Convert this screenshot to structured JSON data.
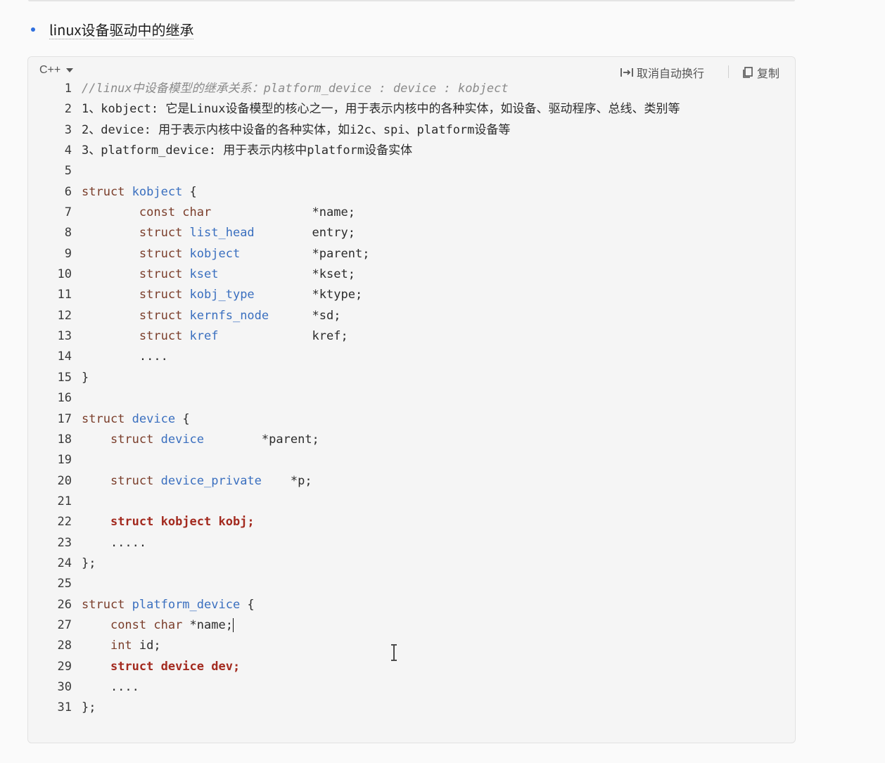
{
  "bullet": {
    "text": "linux设备驱动中的继承"
  },
  "code_block": {
    "language": "C++",
    "wrap_toggle_label": "取消自动换行",
    "copy_label": "复制",
    "line_numbers": [
      "1",
      "2",
      "3",
      "4",
      "5",
      "6",
      "7",
      "8",
      "9",
      "10",
      "11",
      "12",
      "13",
      "14",
      "15",
      "16",
      "17",
      "18",
      "19",
      "20",
      "21",
      "22",
      "23",
      "24",
      "25",
      "26",
      "27",
      "28",
      "29",
      "30",
      "31"
    ],
    "lines": [
      [
        {
          "t": "//linux中设备模型的继承关系：platform_device : device : kobject",
          "c": "comment"
        }
      ],
      [
        {
          "t": "1、kobject: 它是Linux设备模型的核心之一，用于表示内核中的各种实体，如设备、驱动程序、总线、类别等",
          "c": "plain"
        }
      ],
      [
        {
          "t": "2、device: 用于表示内核中设备的各种实体，如i2c、spi、platform设备等",
          "c": "plain"
        }
      ],
      [
        {
          "t": "3、platform_device: 用于表示内核中platform设备实体",
          "c": "plain"
        }
      ],
      [],
      [
        {
          "t": "struct ",
          "c": "kw"
        },
        {
          "t": "kobject",
          "c": "type"
        },
        {
          "t": " {",
          "c": "plain"
        }
      ],
      [
        {
          "t": "        ",
          "c": "plain"
        },
        {
          "t": "const char",
          "c": "kw"
        },
        {
          "t": "              *name;",
          "c": "plain"
        }
      ],
      [
        {
          "t": "        ",
          "c": "plain"
        },
        {
          "t": "struct ",
          "c": "kw"
        },
        {
          "t": "list_head",
          "c": "type"
        },
        {
          "t": "        entry;",
          "c": "plain"
        }
      ],
      [
        {
          "t": "        ",
          "c": "plain"
        },
        {
          "t": "struct ",
          "c": "kw"
        },
        {
          "t": "kobject",
          "c": "type"
        },
        {
          "t": "          *parent;",
          "c": "plain"
        }
      ],
      [
        {
          "t": "        ",
          "c": "plain"
        },
        {
          "t": "struct ",
          "c": "kw"
        },
        {
          "t": "kset",
          "c": "type"
        },
        {
          "t": "             *kset;",
          "c": "plain"
        }
      ],
      [
        {
          "t": "        ",
          "c": "plain"
        },
        {
          "t": "struct ",
          "c": "kw"
        },
        {
          "t": "kobj_type",
          "c": "type"
        },
        {
          "t": "        *ktype;",
          "c": "plain"
        }
      ],
      [
        {
          "t": "        ",
          "c": "plain"
        },
        {
          "t": "struct ",
          "c": "kw"
        },
        {
          "t": "kernfs_node",
          "c": "type"
        },
        {
          "t": "      *sd;",
          "c": "plain"
        }
      ],
      [
        {
          "t": "        ",
          "c": "plain"
        },
        {
          "t": "struct ",
          "c": "kw"
        },
        {
          "t": "kref",
          "c": "type"
        },
        {
          "t": "             kref;",
          "c": "plain"
        }
      ],
      [
        {
          "t": "        ....",
          "c": "plain"
        }
      ],
      [
        {
          "t": "}",
          "c": "plain"
        }
      ],
      [],
      [
        {
          "t": "struct ",
          "c": "kw"
        },
        {
          "t": "device",
          "c": "type"
        },
        {
          "t": " {",
          "c": "plain"
        }
      ],
      [
        {
          "t": "    ",
          "c": "plain"
        },
        {
          "t": "struct ",
          "c": "kw"
        },
        {
          "t": "device",
          "c": "type"
        },
        {
          "t": "        *parent;",
          "c": "plain"
        }
      ],
      [],
      [
        {
          "t": "    ",
          "c": "plain"
        },
        {
          "t": "struct ",
          "c": "kw"
        },
        {
          "t": "device_private",
          "c": "type"
        },
        {
          "t": "    *p;",
          "c": "plain"
        }
      ],
      [],
      [
        {
          "t": "    ",
          "c": "plain"
        },
        {
          "t": "struct kobject kobj;",
          "c": "strong"
        }
      ],
      [
        {
          "t": "    .....",
          "c": "plain"
        }
      ],
      [
        {
          "t": "};",
          "c": "plain"
        }
      ],
      [],
      [
        {
          "t": "struct ",
          "c": "kw"
        },
        {
          "t": "platform_device",
          "c": "type"
        },
        {
          "t": " {",
          "c": "plain"
        }
      ],
      [
        {
          "t": "    ",
          "c": "plain"
        },
        {
          "t": "const char",
          "c": "kw"
        },
        {
          "t": " *name;",
          "c": "plain"
        },
        {
          "t": "",
          "c": "caret"
        }
      ],
      [
        {
          "t": "    ",
          "c": "plain"
        },
        {
          "t": "int",
          "c": "kw"
        },
        {
          "t": " id;",
          "c": "plain"
        }
      ],
      [
        {
          "t": "    ",
          "c": "plain"
        },
        {
          "t": "struct device dev;",
          "c": "strong"
        }
      ],
      [
        {
          "t": "    ....",
          "c": "plain"
        }
      ],
      [
        {
          "t": "};",
          "c": "plain"
        }
      ]
    ]
  }
}
